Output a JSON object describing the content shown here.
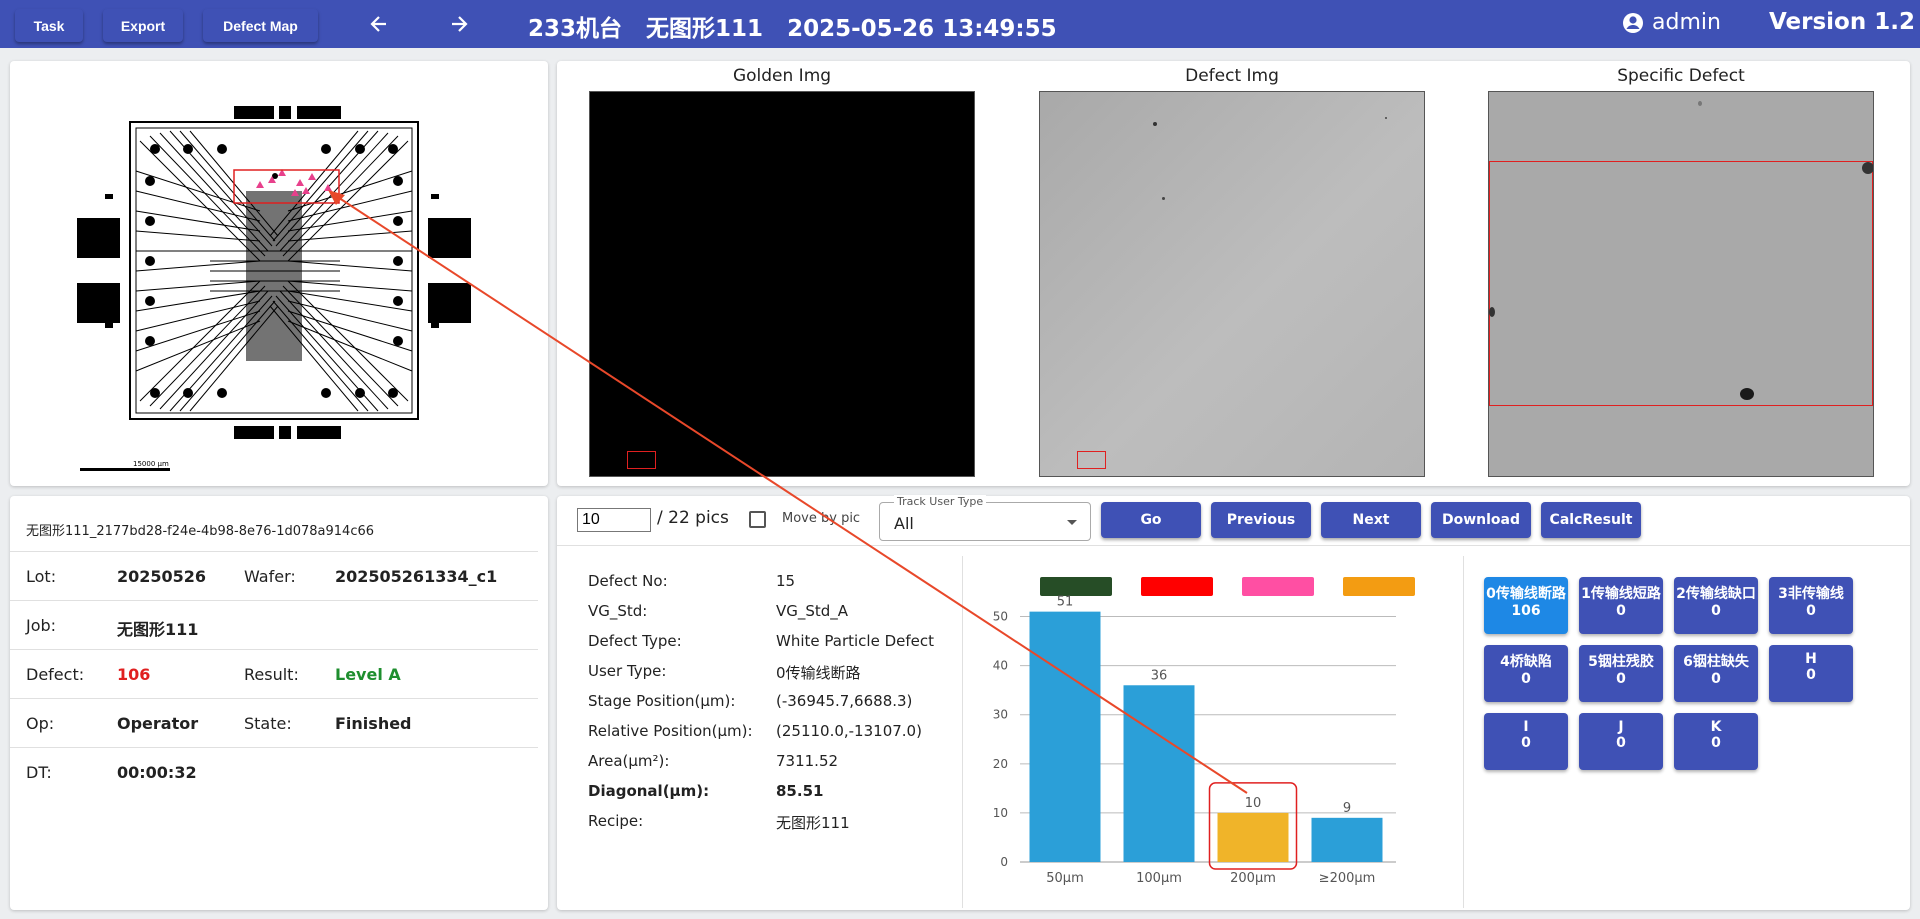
{
  "toolbar": {
    "task": "Task",
    "export": "Export",
    "defect_map": "Defect Map"
  },
  "header": {
    "title": "233机台   无图形111   2025-05-26 13:49:55",
    "user": "admin",
    "version": "Version 1.2"
  },
  "wafer_map": {
    "scale_label": "15000 µm"
  },
  "images": {
    "golden": "Golden Img",
    "defect": "Defect Img",
    "specific": "Specific Defect"
  },
  "info": {
    "uuid": "无图形111_2177bd28-f24e-4b98-8e76-1d078a914c66",
    "lot_label": "Lot:",
    "lot": "20250526",
    "wafer_label": "Wafer:",
    "wafer": "202505261334_c1",
    "job_label": "Job:",
    "job": "无图形111",
    "defect_label": "Defect:",
    "defect": "106",
    "result_label": "Result:",
    "result": "Level A",
    "op_label": "Op:",
    "op": "Operator",
    "state_label": "State:",
    "state": "Finished",
    "dt_label": "DT:",
    "dt": "00:00:32"
  },
  "controls": {
    "pic_value": "10",
    "pic_total": "/ 22 pics",
    "move_by_pic": "Move by pic",
    "track_label": "Track User Type",
    "track_value": "All",
    "go": "Go",
    "previous": "Previous",
    "next": "Next",
    "download": "Download",
    "calc": "CalcResult"
  },
  "details": {
    "defect_no_label": "Defect No:",
    "defect_no": "15",
    "vg_std_label": "VG_Std:",
    "vg_std": "VG_Std_A",
    "defect_type_label": "Defect Type:",
    "defect_type": "White Particle Defect",
    "user_type_label": "User Type:",
    "user_type": "0传输线断路",
    "stage_pos_label": "Stage Position(µm):",
    "stage_pos": "(-36945.7,6688.3)",
    "rel_pos_label": "Relative Position(µm):",
    "rel_pos": "(25110.0,-13107.0)",
    "area_label": "Area(µm²):",
    "area": "7311.52",
    "diagonal_label": "Diagonal(µm):",
    "diagonal": "85.51",
    "recipe_label": "Recipe:",
    "recipe": "无图形111"
  },
  "chart_data": {
    "type": "bar",
    "categories": [
      "50µm",
      "100µm",
      "200µm",
      "≥200µm"
    ],
    "values": [
      51,
      36,
      10,
      9
    ],
    "highlight_index": 2,
    "ylim": [
      0,
      55
    ],
    "yticks": [
      "0",
      "10",
      "20",
      "30",
      "40",
      "50"
    ],
    "legend_colors": [
      "#264d26",
      "#ff0000",
      "#ff4fa3",
      "#f39c12"
    ],
    "bar_color": "#2b9fd8",
    "highlight_color": "#f0b429"
  },
  "classes": [
    {
      "name": "0传输线断路",
      "count": "106",
      "active": true
    },
    {
      "name": "1传输线短路",
      "count": "0"
    },
    {
      "name": "2传输线缺口",
      "count": "0"
    },
    {
      "name": "3非传输线",
      "count": "0"
    },
    {
      "name": "4桥缺陷",
      "count": "0"
    },
    {
      "name": "5铟柱残胶",
      "count": "0"
    },
    {
      "name": "6铟柱缺失",
      "count": "0"
    },
    {
      "name": "H",
      "count": "0"
    },
    {
      "name": "I",
      "count": "0"
    },
    {
      "name": "J",
      "count": "0"
    },
    {
      "name": "K",
      "count": "0"
    }
  ]
}
